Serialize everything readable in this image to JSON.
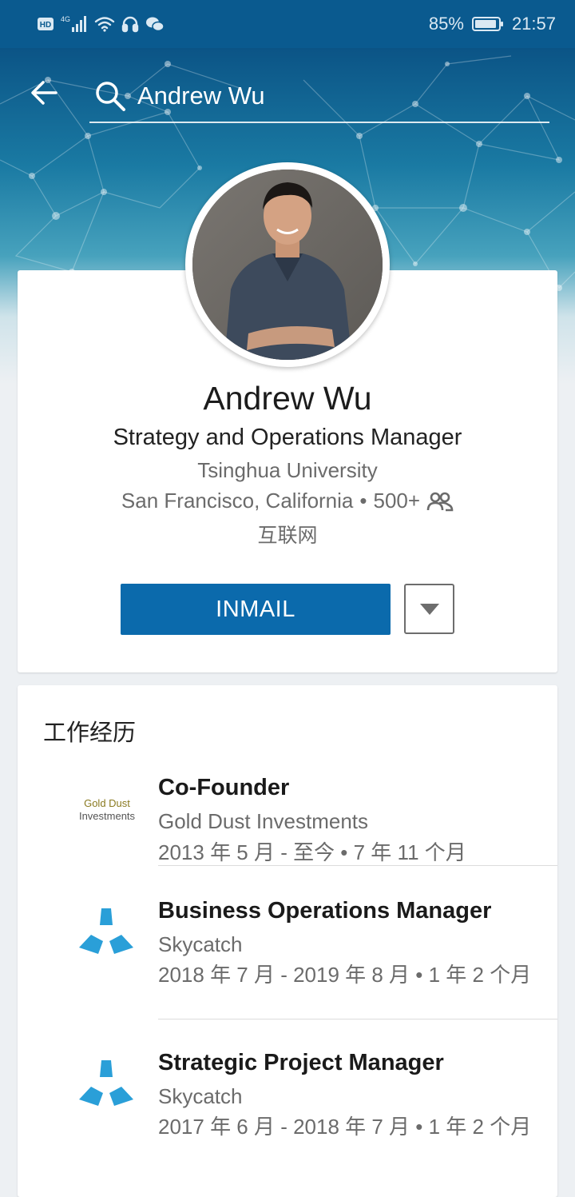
{
  "status_bar": {
    "left_icons": [
      "hd-icon",
      "signal-icon",
      "wifi-icon",
      "headset-icon",
      "wechat-icon"
    ],
    "network_badge": "4G",
    "battery": "85%",
    "time": "21:57"
  },
  "search": {
    "query": "Andrew Wu"
  },
  "profile": {
    "name": "Andrew Wu",
    "headline": "Strategy and Operations Manager",
    "school": "Tsinghua University",
    "location": "San Francisco, California",
    "separator": "•",
    "connections": "500+",
    "industry": "互联网"
  },
  "actions": {
    "inmail_label": "INMAIL"
  },
  "experience": {
    "title": "工作经历",
    "items": [
      {
        "role": "Co-Founder",
        "company": "Gold Dust Investments",
        "dates": "2013 年 5 月 - 至今 • 7 年 11 个月",
        "logo": {
          "line1": "Gold Dust",
          "line2": "Investments"
        }
      },
      {
        "role": "Business Operations Manager",
        "company": "Skycatch",
        "dates": "2018 年 7 月 - 2019 年 8 月 • 1 年 2 个月",
        "logo": "skycatch-logo"
      },
      {
        "role": "Strategic Project Manager",
        "company": "Skycatch",
        "dates": "2017 年 6 月 - 2018 年 7 月 • 1 年 2 个月",
        "logo": "skycatch-logo"
      }
    ]
  },
  "colors": {
    "status_bar": "#0a5a8f",
    "primary_button": "#0b6aac",
    "skycatch_blue": "#2a9fd8",
    "page_bg": "#edf0f3"
  }
}
